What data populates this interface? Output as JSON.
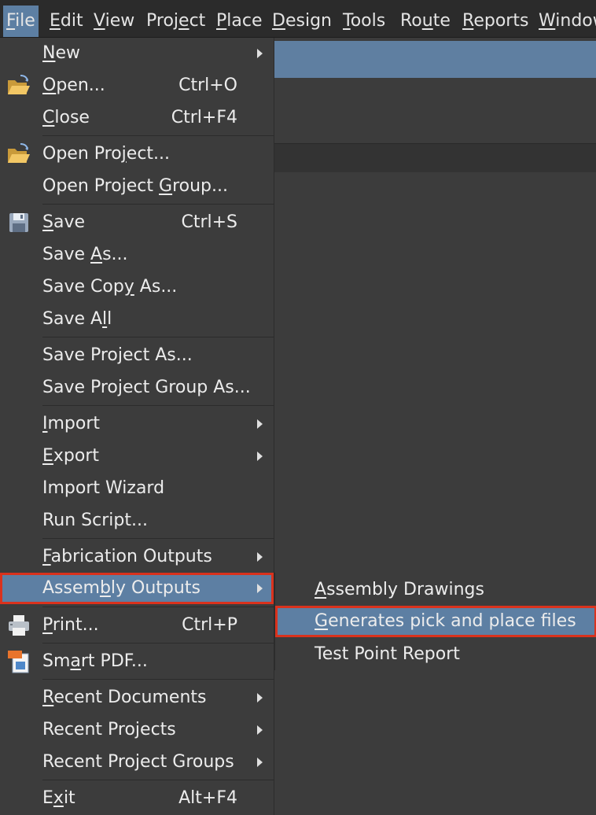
{
  "menubar": {
    "items": [
      {
        "pre": "",
        "u": "F",
        "post": "ile"
      },
      {
        "pre": "",
        "u": "E",
        "post": "dit"
      },
      {
        "pre": "",
        "u": "V",
        "post": "iew"
      },
      {
        "pre": "Proj",
        "u": "e",
        "post": "ct"
      },
      {
        "pre": "",
        "u": "P",
        "post": "lace"
      },
      {
        "pre": "",
        "u": "D",
        "post": "esign"
      },
      {
        "pre": "",
        "u": "T",
        "post": "ools"
      },
      {
        "pre": "Ro",
        "u": "u",
        "post": "te"
      },
      {
        "pre": "",
        "u": "R",
        "post": "eports"
      },
      {
        "pre": "",
        "u": "W",
        "post": "indow"
      }
    ]
  },
  "file_menu": {
    "items": [
      {
        "pre": "",
        "u": "N",
        "post": "ew",
        "shortcut": "",
        "submenu": true
      },
      {
        "pre": "",
        "u": "O",
        "post": "pen...",
        "shortcut": "Ctrl+O",
        "icon": "open-folder-icon"
      },
      {
        "pre": "",
        "u": "C",
        "post": "lose",
        "shortcut": "Ctrl+F4"
      },
      {
        "pre": "Open Pro",
        "u": "j",
        "post": "ect...",
        "shortcut": "",
        "icon": "open-project-icon"
      },
      {
        "pre": "Open Project ",
        "u": "G",
        "post": "roup...",
        "shortcut": ""
      },
      {
        "pre": "",
        "u": "S",
        "post": "ave",
        "shortcut": "Ctrl+S",
        "icon": "save-icon"
      },
      {
        "pre": "Save ",
        "u": "A",
        "post": "s...",
        "shortcut": ""
      },
      {
        "pre": "Save Cop",
        "u": "y",
        "post": " As...",
        "shortcut": ""
      },
      {
        "pre": "Save A",
        "u": "l",
        "post": "l",
        "shortcut": ""
      },
      {
        "pre": "Save Project As...",
        "u": "",
        "post": "",
        "shortcut": ""
      },
      {
        "pre": "Save Project Group As...",
        "u": "",
        "post": "",
        "shortcut": ""
      },
      {
        "pre": "",
        "u": "I",
        "post": "mport",
        "shortcut": "",
        "submenu": true
      },
      {
        "pre": "",
        "u": "E",
        "post": "xport",
        "shortcut": "",
        "submenu": true
      },
      {
        "pre": "Import Wizard",
        "u": "",
        "post": "",
        "shortcut": ""
      },
      {
        "pre": "Run Script...",
        "u": "",
        "post": "",
        "shortcut": ""
      },
      {
        "pre": "",
        "u": "F",
        "post": "abrication Outputs",
        "shortcut": "",
        "submenu": true
      },
      {
        "pre": "Assem",
        "u": "b",
        "post": "ly Outputs",
        "shortcut": "",
        "submenu": true
      },
      {
        "pre": "",
        "u": "P",
        "post": "rint...",
        "shortcut": "Ctrl+P",
        "icon": "printer-icon"
      },
      {
        "pre": "Sm",
        "u": "a",
        "post": "rt PDF...",
        "shortcut": "",
        "icon": "smart-pdf-icon"
      },
      {
        "pre": "",
        "u": "R",
        "post": "ecent Documents",
        "shortcut": "",
        "submenu": true
      },
      {
        "pre": "Recent Projects",
        "u": "",
        "post": "",
        "shortcut": "",
        "submenu": true
      },
      {
        "pre": "Recent Project Groups",
        "u": "",
        "post": "",
        "shortcut": "",
        "submenu": true
      },
      {
        "pre": "E",
        "u": "x",
        "post": "it",
        "shortcut": "Alt+F4"
      }
    ]
  },
  "assembly_submenu": {
    "items": [
      {
        "pre": "",
        "u": "A",
        "post": "ssembly Drawings"
      },
      {
        "pre": "",
        "u": "G",
        "post": "enerates pick and place files"
      },
      {
        "pre": "Test Point Report",
        "u": "",
        "post": ""
      }
    ]
  },
  "colors": {
    "menu_bg": "#3c3c3c",
    "menubar_bg": "#2b2b2b",
    "highlight": "#5d7fa3",
    "callout_border": "#d9321d",
    "text": "#ececec"
  }
}
